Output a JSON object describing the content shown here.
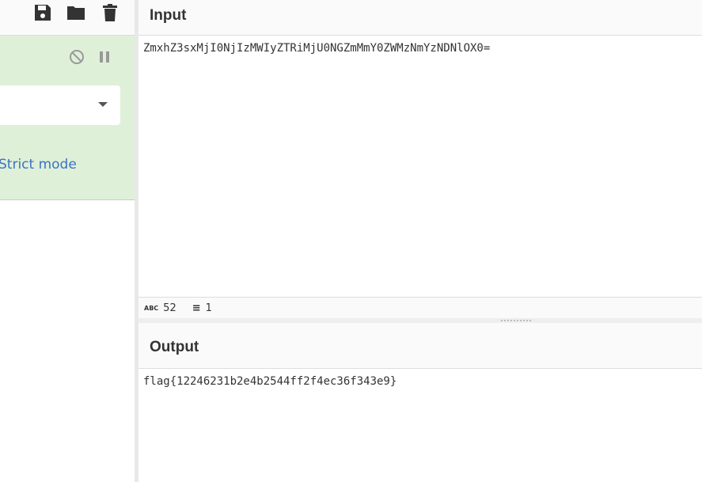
{
  "toolbar": {
    "icons": [
      "save-icon",
      "folder-icon",
      "trash-icon"
    ]
  },
  "recipe": {
    "operation_icons": [
      "disable-icon",
      "pause-icon"
    ],
    "dropdown_value": "",
    "strict_mode_label": "Strict mode",
    "color": "#dff0d8"
  },
  "input": {
    "title": "Input",
    "value": "ZmxhZ3sxMjI0NjIzMWIyZTRiMjU0NGZmMmY0ZWMzNmYzNDNlOX0=",
    "status": {
      "chars": "52",
      "lines": "1",
      "chars_icon": "abc-icon",
      "lines_icon": "lines-icon"
    }
  },
  "output": {
    "title": "Output",
    "value": "flag{12246231b2e4b2544ff2f4ec36f343e9}"
  }
}
